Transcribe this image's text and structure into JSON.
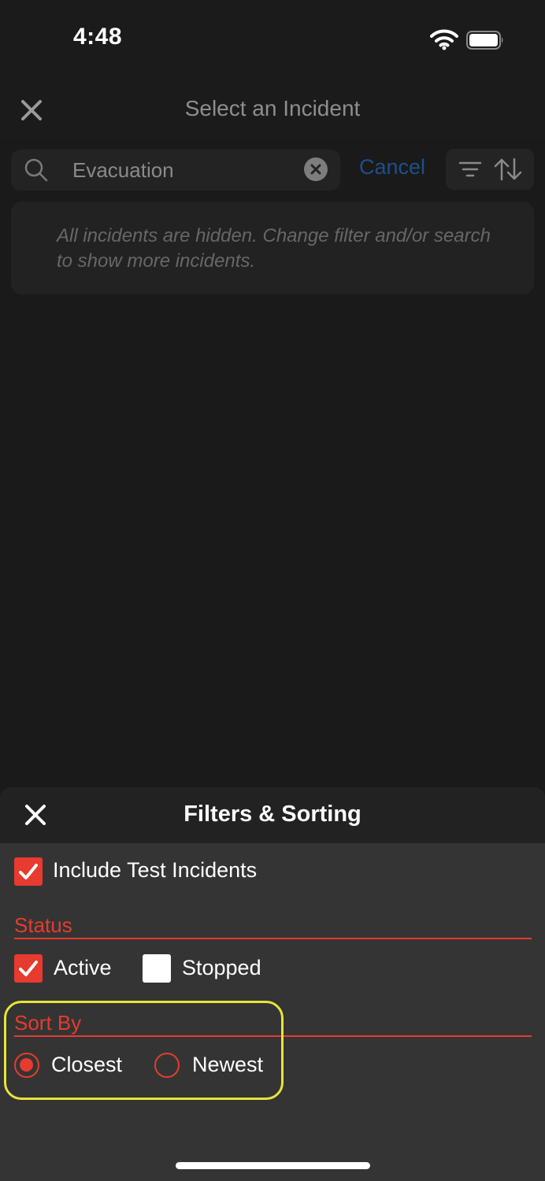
{
  "status_bar": {
    "time": "4:48"
  },
  "nav": {
    "title": "Select an Incident"
  },
  "search": {
    "value": "Evacuation",
    "cancel_label": "Cancel"
  },
  "empty_message": "All incidents are hidden. Change filter and/or search to show more incidents.",
  "sheet": {
    "title": "Filters & Sorting",
    "include_test": {
      "label": "Include Test Incidents",
      "checked": true
    },
    "status_section": {
      "label": "Status",
      "options": [
        {
          "label": "Active",
          "checked": true
        },
        {
          "label": "Stopped",
          "checked": false
        }
      ]
    },
    "sort_section": {
      "label": "Sort By",
      "options": [
        {
          "label": "Closest",
          "selected": true
        },
        {
          "label": "Newest",
          "selected": false
        }
      ]
    }
  },
  "colors": {
    "accent": "#e63b2e",
    "link": "#1e4f8a",
    "highlight": "#e9e33a",
    "background": "#1a1a1a",
    "sheet": "#343434"
  },
  "icons": [
    "wifi-icon",
    "battery-icon",
    "close-icon",
    "search-icon",
    "clear-icon",
    "filter-icon",
    "sort-icon",
    "checkmark-icon"
  ]
}
